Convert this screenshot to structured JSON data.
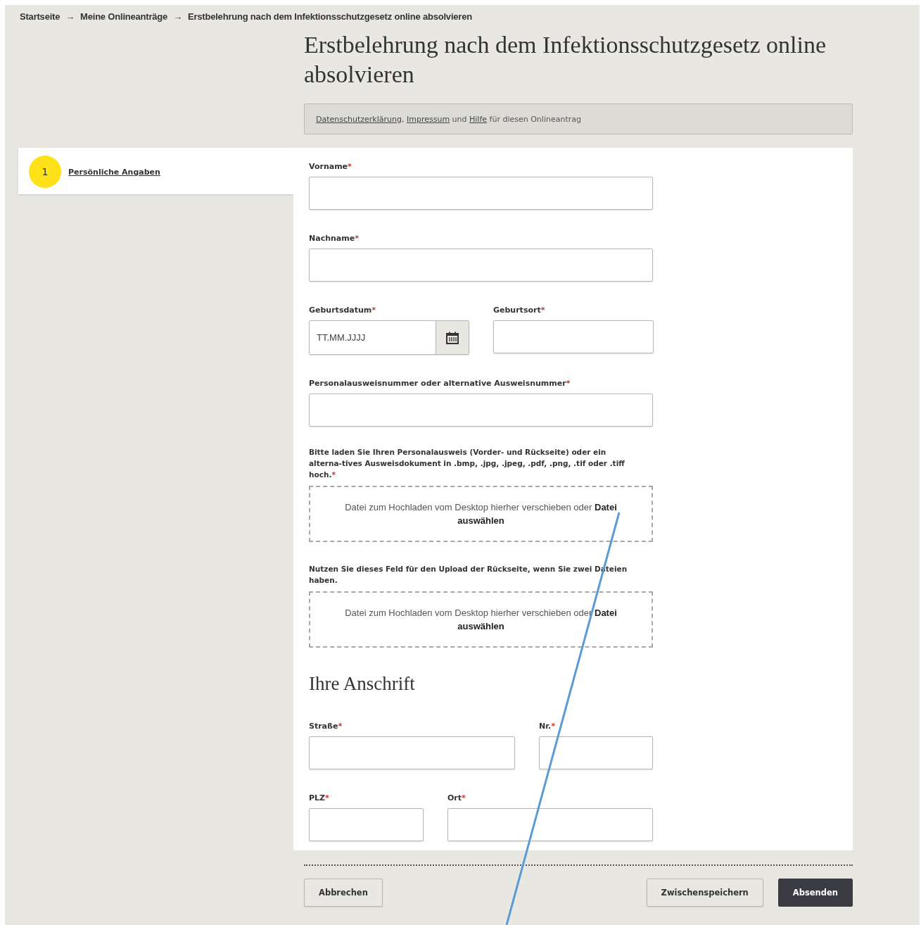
{
  "breadcrumb": [
    {
      "label": "Startseite"
    },
    {
      "label": "Meine Onlineanträge"
    },
    {
      "label": "Erstbelehrung nach dem Infektionsschutzgesetz online absolvieren"
    }
  ],
  "breadcrumb_separator": "→",
  "title": "Erstbelehrung nach dem Infektionsschutzgesetz online absolvieren",
  "info": [
    {
      "kind": "link",
      "text": "Datenschutzerklärung"
    },
    {
      "kind": "text",
      "text": ", "
    },
    {
      "kind": "link",
      "text": "Impressum"
    },
    {
      "kind": "text",
      "text": " und "
    },
    {
      "kind": "link",
      "text": "Hilfe"
    },
    {
      "kind": "text",
      "text": " für diesen Onlineantrag"
    }
  ],
  "steps": [
    {
      "number": "1",
      "label": "Persönliche Angaben",
      "selected": true
    }
  ],
  "form": [
    {
      "kind": "text",
      "label": "Vorname",
      "required_mark": "*"
    },
    {
      "kind": "text",
      "label": "Nachname",
      "required_mark": "*"
    },
    {
      "kind": "pair",
      "fields": [
        {
          "kind": "date",
          "label": "Geburtsdatum",
          "required_mark": "*",
          "placeholder": "TT.MM.JJJJ"
        },
        {
          "kind": "text",
          "label": "Geburtsort",
          "required_mark": "*"
        }
      ]
    },
    {
      "kind": "text",
      "label": "Personalausweisnummer oder alternative Ausweisnummer",
      "required_mark": "*"
    },
    {
      "kind": "upload",
      "label": "Bitte laden Sie Ihren Personalausweis (Vorder- und Rückseite) oder ein alterna-tives Ausweisdokument in .bmp, .jpg, .jpeg, .pdf, .png, .tif oder .tiff hoch.",
      "required_mark": "*",
      "drop_text": "Datei zum Hochladen vom Desktop hierher verschieben oder **Datei auswählen**"
    },
    {
      "kind": "upload",
      "label": "Nutzen Sie dieses Feld für den Upload der Rückseite, wenn Sie zwei Dateien haben.",
      "drop_text": "Datei zum Hochladen vom Desktop hierher verschieben oder **Datei auswählen**"
    },
    {
      "kind": "heading",
      "label": "Ihre Anschrift"
    },
    {
      "kind": "pair",
      "fields": [
        {
          "kind": "text",
          "label": "Straße",
          "required_mark": "*"
        },
        {
          "kind": "text",
          "label": "Nr.",
          "required_mark": "*"
        }
      ]
    },
    {
      "kind": "pair",
      "fields": [
        {
          "kind": "text",
          "label": "PLZ",
          "required_mark": "*"
        },
        {
          "kind": "text",
          "label": "Ort",
          "required_mark": "*"
        }
      ]
    }
  ],
  "buttons": [
    {
      "label": "Abbrechen",
      "kind": "secondary"
    },
    {
      "label": "Zwischenspeichern",
      "kind": "secondary"
    },
    {
      "label": "Absenden",
      "kind": "primary"
    }
  ]
}
